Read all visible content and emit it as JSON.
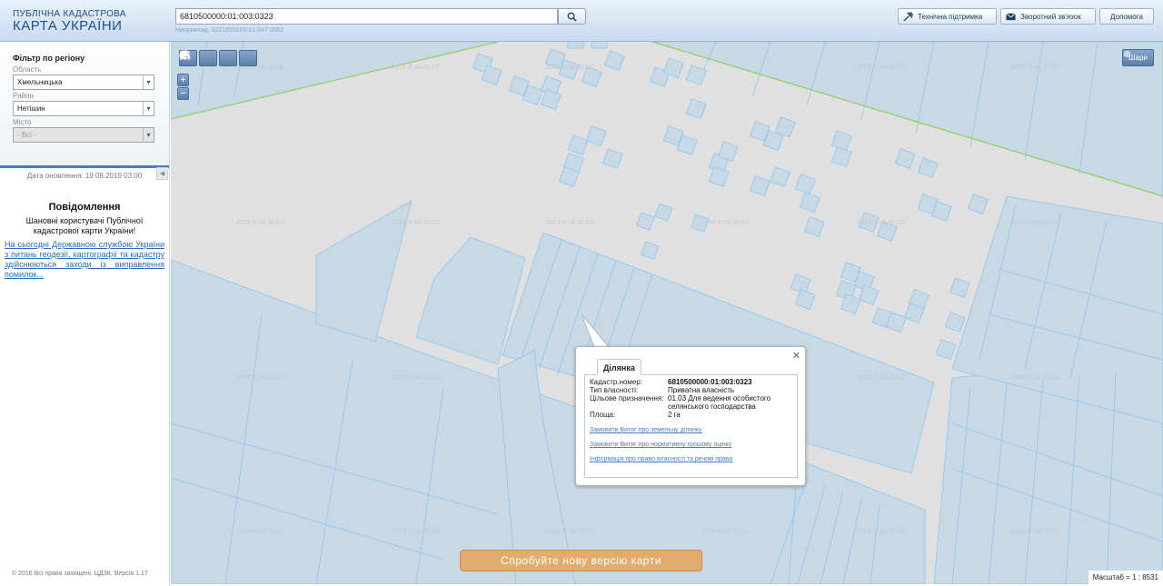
{
  "header": {
    "logo_line1": "ПУБЛІЧНА КАДАСТРОВА",
    "logo_line2": "КАРТА УКРАЇНИ",
    "search_value": "6810500000:01:003:0323",
    "search_example": "Наприклад: 3221655100:01:047:0052",
    "buttons": {
      "support": "Технічна підтримка",
      "feedback": "Зворотний зв'язок",
      "help": "Допомога"
    }
  },
  "sidebar": {
    "filter_title": "Фільтр по регіону",
    "region_label": "Область",
    "region_value": "Хмельницька",
    "district_label": "Район",
    "district_value": "Нетішин",
    "city_label": "Місто",
    "city_value": "- Всі -",
    "update_date": "Дата оновлення: 19.08.2019 03:00",
    "news_title": "Повідомлення",
    "news_text": "Шановні користувачі Публічної кадастрової карти України!",
    "news_link": "На сьогодні Державною службою України з питань геодезії, картографії та кадастру здійснюються заходи із виправлення помилок...",
    "copyright": "© 2016 Всі права захищені. ЦДЗК. Версія 1.17"
  },
  "map": {
    "tools": [
      "I м",
      "I ⌐ мг",
      "print",
      "?"
    ],
    "layers_label": "Шари",
    "watermark": "2019 ® ciii.SI.CC",
    "new_version_label": "Спробуйте нову версію карти",
    "scale_label": "Масштаб = 1 : 8531"
  },
  "popup": {
    "tab_label": "Ділянка",
    "fields": [
      {
        "key": "Кадастр.номер:",
        "value": "6810500000:01:003:0323"
      },
      {
        "key": "Тип власності:",
        "value": "Приватна власність"
      },
      {
        "key": "Цільове призначення:",
        "value": "01.03 Для ведення особистого селянського господарства"
      },
      {
        "key": "Площа:",
        "value": "2 га"
      }
    ],
    "links": [
      "Замовити Витяг про земельну ділянку",
      "Замовити Витяг про нормативну грошову оцінку",
      "Інформація про право власності та речові права"
    ]
  }
}
